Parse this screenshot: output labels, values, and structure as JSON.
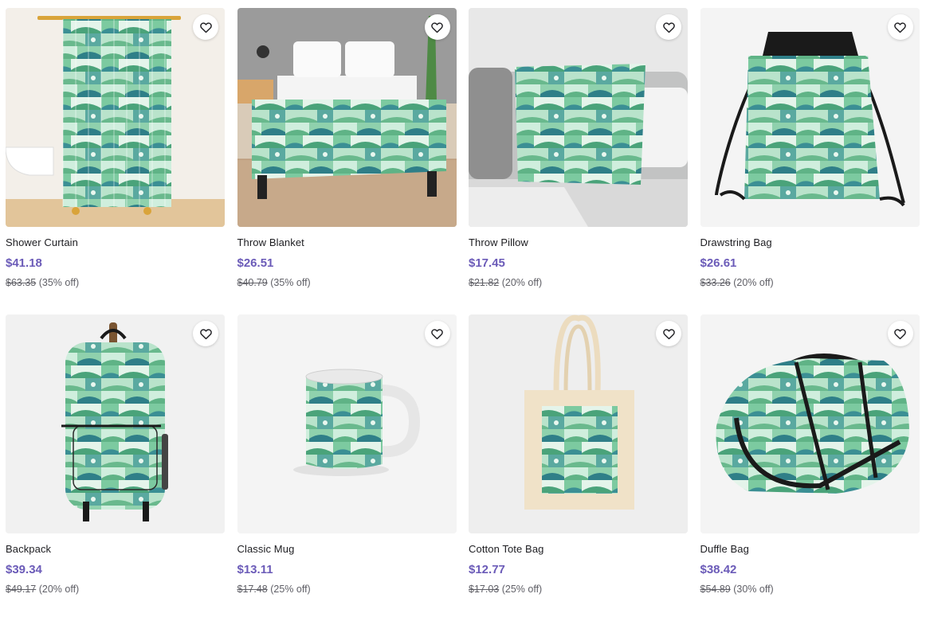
{
  "products": [
    {
      "title": "Shower Curtain",
      "price": "$41.18",
      "original": "$63.35",
      "discount": "(35% off)",
      "image": "shower-curtain"
    },
    {
      "title": "Throw Blanket",
      "price": "$26.51",
      "original": "$40.79",
      "discount": "(35% off)",
      "image": "throw-blanket"
    },
    {
      "title": "Throw Pillow",
      "price": "$17.45",
      "original": "$21.82",
      "discount": "(20% off)",
      "image": "throw-pillow"
    },
    {
      "title": "Drawstring Bag",
      "price": "$26.61",
      "original": "$33.26",
      "discount": "(20% off)",
      "image": "drawstring-bag"
    },
    {
      "title": "Backpack",
      "price": "$39.34",
      "original": "$49.17",
      "discount": "(20% off)",
      "image": "backpack"
    },
    {
      "title": "Classic Mug",
      "price": "$13.11",
      "original": "$17.48",
      "discount": "(25% off)",
      "image": "classic-mug"
    },
    {
      "title": "Cotton Tote Bag",
      "price": "$12.77",
      "original": "$17.03",
      "discount": "(25% off)",
      "image": "cotton-tote-bag"
    },
    {
      "title": "Duffle Bag",
      "price": "$38.42",
      "original": "$54.89",
      "discount": "(30% off)",
      "image": "duffle-bag"
    }
  ],
  "icons": {
    "favorite": "heart-outline-icon"
  },
  "colors": {
    "price": "#6b5bb8",
    "pattern_light": "#a8dcc0",
    "pattern_mid": "#6cbf92",
    "pattern_dark": "#2f7f88"
  }
}
